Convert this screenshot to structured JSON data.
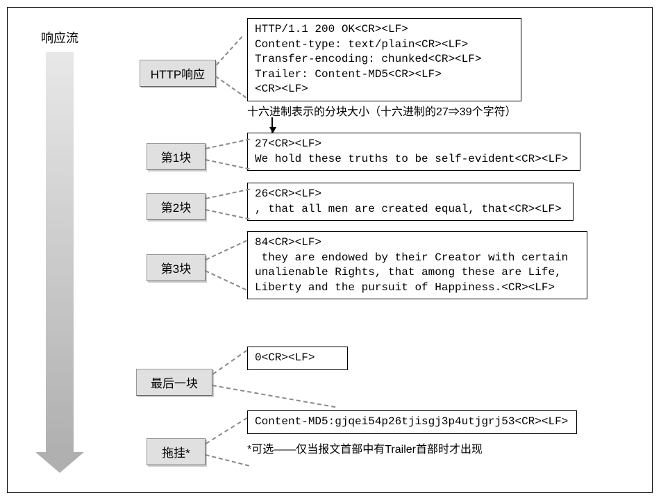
{
  "arrow_label": "响应流",
  "labels": {
    "http_response": "HTTP响应",
    "chunk1": "第1块",
    "chunk2": "第2块",
    "chunk3": "第3块",
    "last_chunk": "最后一块",
    "trailer": "拖挂*"
  },
  "boxes": {
    "http_response": "HTTP/1.1 200 OK<CR><LF>\nContent-type: text/plain<CR><LF>\nTransfer-encoding: chunked<CR><LF>\nTrailer: Content-MD5<CR><LF>\n<CR><LF>",
    "chunk1": "27<CR><LF>\nWe hold these truths to be self-evident<CR><LF>",
    "chunk2": "26<CR><LF>\n, that all men are created equal, that<CR><LF>",
    "chunk3": "84<CR><LF>\n they are endowed by their Creator with certain\nunalienable Rights, that among these are Life,\nLiberty and the pursuit of Happiness.<CR><LF>",
    "last_chunk": "0<CR><LF>",
    "trailer": "Content-MD5:gjqei54p26tjisgj3p4utjgrj53<CR><LF>"
  },
  "annotation": "十六进制表示的分块大小（十六进制的27⇒39个字符）",
  "footnote": "*可选——仅当报文首部中有Trailer首部时才出现"
}
